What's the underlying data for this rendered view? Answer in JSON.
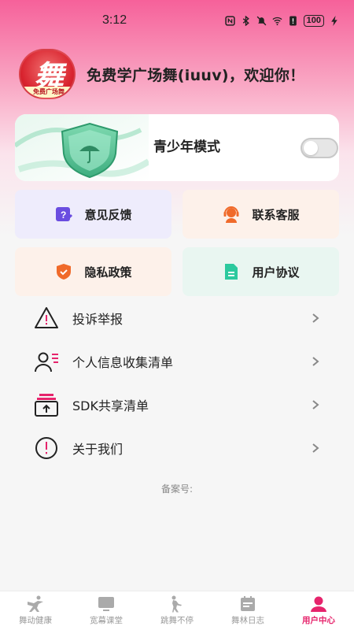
{
  "status_bar": {
    "time": "3:12",
    "battery": "100"
  },
  "header": {
    "logo_char": "舞",
    "logo_strip": "免费广场舞",
    "welcome": "免费学广场舞(iuuv)，欢迎你！"
  },
  "teen_mode": {
    "label": "青少年模式",
    "enabled": false
  },
  "quick_actions": [
    {
      "label": "意见反馈",
      "icon": "feedback-icon",
      "bg": "#eeecfc",
      "color": "#6a4de0"
    },
    {
      "label": "联系客服",
      "icon": "customer-service-icon",
      "bg": "#fdf1ea",
      "color": "#f06a2a"
    },
    {
      "label": "隐私政策",
      "icon": "shield-icon",
      "bg": "#fdf1ea",
      "color": "#f06a2a"
    },
    {
      "label": "用户协议",
      "icon": "document-icon",
      "bg": "#e9f6f1",
      "color": "#2cc99e"
    }
  ],
  "menu": [
    {
      "label": "投诉举报",
      "icon": "warning-icon"
    },
    {
      "label": "个人信息收集清单",
      "icon": "user-list-icon"
    },
    {
      "label": "SDK共享清单",
      "icon": "share-box-icon"
    },
    {
      "label": "关于我们",
      "icon": "info-icon"
    }
  ],
  "beian": "备案号:",
  "tabs": [
    {
      "label": "舞动健康",
      "icon": "dance-icon",
      "active": false
    },
    {
      "label": "宽幕课堂",
      "icon": "tv-icon",
      "active": false
    },
    {
      "label": "跳舞不停",
      "icon": "dancer-icon",
      "active": false
    },
    {
      "label": "舞林日志",
      "icon": "calendar-icon",
      "active": false
    },
    {
      "label": "用户中心",
      "icon": "user-icon",
      "active": true
    }
  ],
  "colors": {
    "accent": "#e6246c",
    "gradient_top": "#f6619a"
  }
}
